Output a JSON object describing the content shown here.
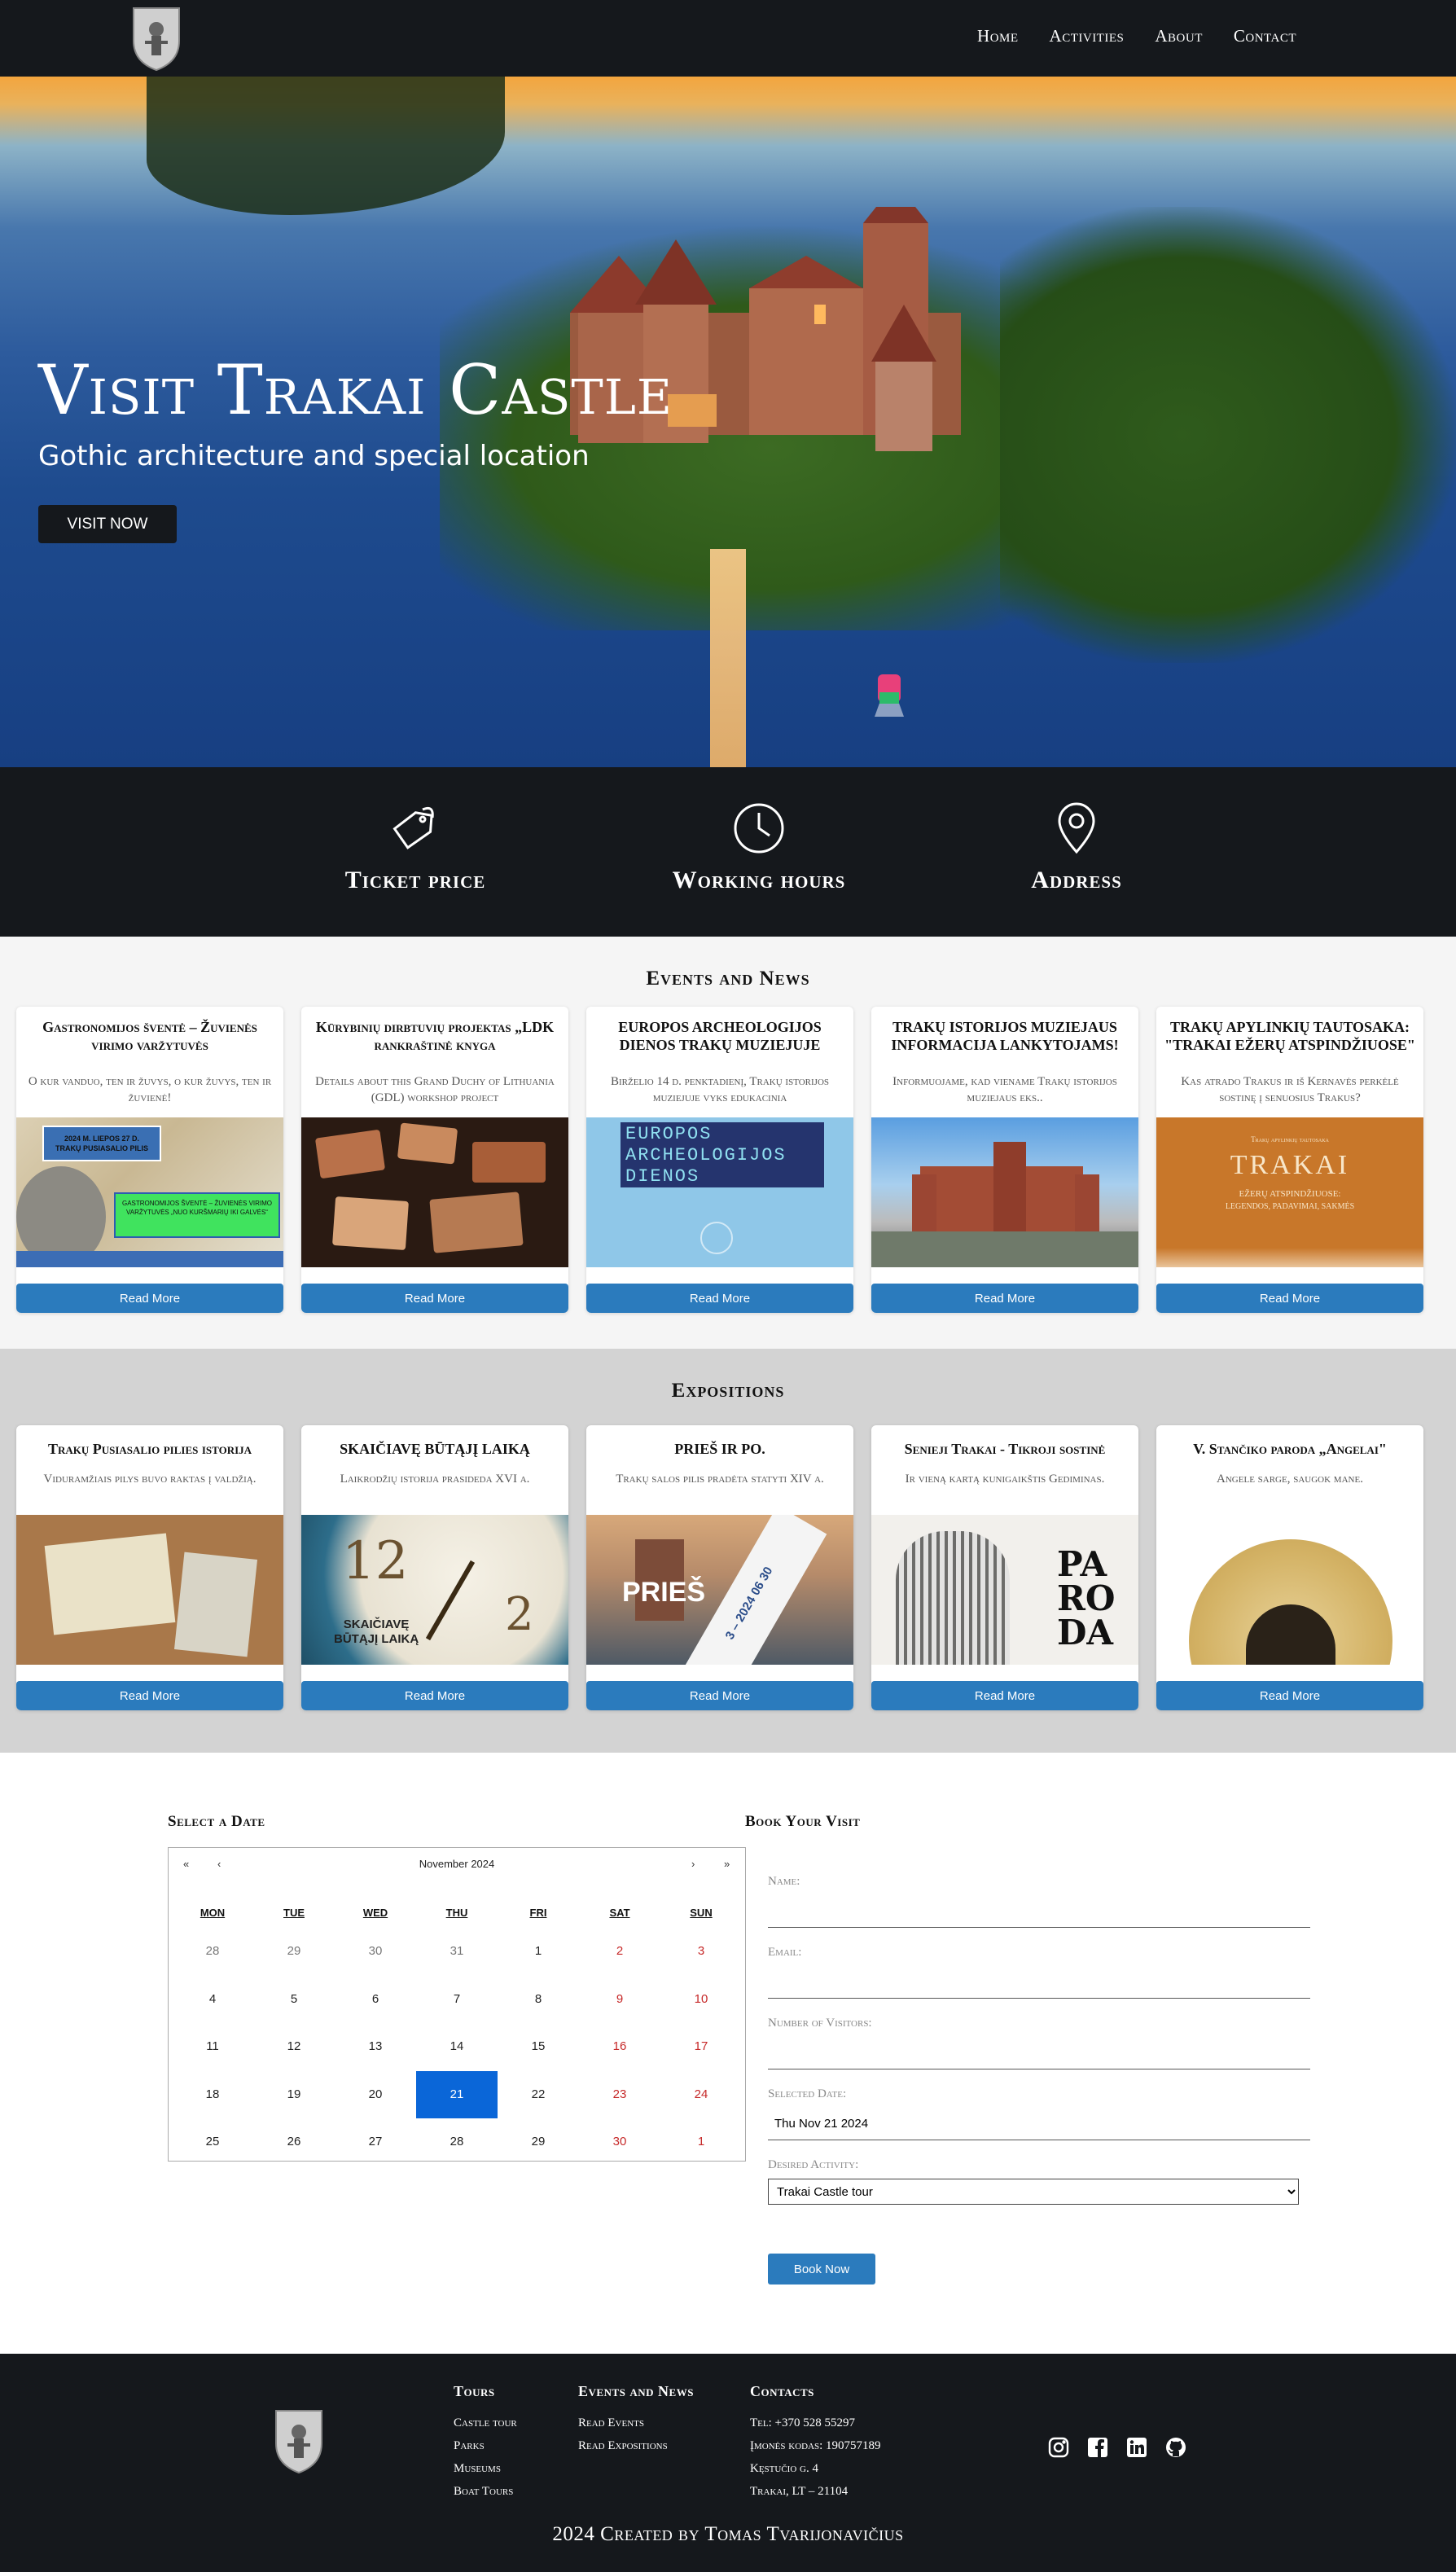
{
  "nav": {
    "links": [
      "Home",
      "Activities",
      "About",
      "Contact"
    ]
  },
  "hero": {
    "title": "Visit Trakai Castle",
    "subtitle": "Gothic architecture and special location",
    "button": "VISIT NOW"
  },
  "info": {
    "items": [
      {
        "label": "Ticket price",
        "icon": "price-tag-icon"
      },
      {
        "label": "Working hours",
        "icon": "clock-icon"
      },
      {
        "label": "Address",
        "icon": "map-pin-icon"
      }
    ]
  },
  "events": {
    "title": "Events and News",
    "read_more": "Read More",
    "cards": [
      {
        "title": "Gastronomijos šventė – Žuvienės virimo varžytuvės",
        "desc": "O kur vanduo, ten ir žuvys, o kur žuvys, ten ir žuvienė!",
        "image_text": [
          "2024 M. LIEPOS 27 D.",
          "TRAKŲ PUSIASALIO PILIS",
          "GASTRONOMIJOS ŠVENTĖ – ŽUVIENĖS VIRIMO VARŽYTUVĖS „NUO KURŠMARIŲ IKI GALVĖS“"
        ]
      },
      {
        "title": "Kūrybinių dirbtuvių projektas „LDK rankraštinė knyga",
        "desc": "Details about this Grand Duchy of Lithuania (GDL) workshop project",
        "image_text": []
      },
      {
        "title": "EUROPOS ARCHEOLOGIJOS DIENOS TRAKŲ MUZIEJUJE",
        "desc": "Birželio 14 d. penktadienį, Trakų istorijos muziejuje vyks edukacinia",
        "image_text": [
          "EUROPOS",
          "ARCHEOLOGIJOS",
          "DIENOS"
        ]
      },
      {
        "title": "TRAKŲ ISTORIJOS MUZIEJAUS INFORMACIJA LANKYTOJAMS!",
        "desc": "Informuojame, kad viename Trakų istorijos muziejaus eks..",
        "image_text": []
      },
      {
        "title": "TRAKŲ APYLINKIŲ TAUTOSAKA: \"TRAKAI EŽERŲ ATSPINDŽIUOSE\"",
        "desc": "Kas atrado Trakus ir iš Kernavės perkėlė sostinę į senuosius Trakus?",
        "image_text": [
          "Trakų apylinkių tautosaka",
          "TRAKAI",
          "EŽERŲ ATSPINDŽIUOSE:",
          "LEGENDOS, PADAVIMAI, SAKMĖS"
        ]
      }
    ]
  },
  "expositions": {
    "title": "Expositions",
    "read_more": "Read More",
    "cards": [
      {
        "title": "Trakų Pusiasalio pilies istorija",
        "desc": "Viduramžiais pilys buvo raktas į valdžią.",
        "image_text": []
      },
      {
        "title": "SKAIČIAVĘ BŪTĄJĮ LAIKĄ",
        "desc": "Laikrodžių istorija prasideda XVI a.",
        "image_text": [
          "SKAIČIAVĘ",
          "BŪTĄJĮ LAIKĄ"
        ]
      },
      {
        "title": "PRIEŠ IR PO.",
        "desc": "Trakų salos pilis pradėta statyti XIV a.",
        "image_text": [
          "PRIEŠ",
          "3 – 2024 06 30"
        ]
      },
      {
        "title": "Senieji Trakai - Tikroji sostinė",
        "desc": "Ir vieną kartą kunigaikštis Gediminas.",
        "image_text": [
          "PA",
          "RO",
          "DA"
        ]
      },
      {
        "title": "V. Stančiko paroda „Angelai\"",
        "desc": "Angele sarge, saugok mane.",
        "image_text": []
      }
    ]
  },
  "calendar": {
    "title": "Select a Date",
    "month_label": "November 2024",
    "nav": {
      "prev_year": "«",
      "prev_month": "‹",
      "next_month": "›",
      "next_year": "»"
    },
    "weekdays": [
      "MON",
      "TUE",
      "WED",
      "THU",
      "FRI",
      "SAT",
      "SUN"
    ],
    "weeks": [
      [
        "28",
        "29",
        "30",
        "31",
        "1",
        "2",
        "3"
      ],
      [
        "4",
        "5",
        "6",
        "7",
        "8",
        "9",
        "10"
      ],
      [
        "11",
        "12",
        "13",
        "14",
        "15",
        "16",
        "17"
      ],
      [
        "18",
        "19",
        "20",
        "21",
        "22",
        "23",
        "24"
      ],
      [
        "25",
        "26",
        "27",
        "28",
        "29",
        "30",
        "1"
      ]
    ],
    "selected": "21"
  },
  "booking": {
    "title": "Book Your Visit",
    "name_label": "Name:",
    "email_label": "Email:",
    "visitors_label": "Number of Visitors:",
    "date_label": "Selected Date:",
    "date_value": "Thu Nov 21 2024",
    "activity_label": "Desired Activity:",
    "activity_value": "Trakai Castle tour",
    "button": "Book Now"
  },
  "footer": {
    "columns": [
      {
        "heading": "Tours",
        "items": [
          "Castle tour",
          "Parks",
          "Museums",
          "Boat Tours"
        ]
      },
      {
        "heading": "Events and News",
        "items": [
          "Read Events",
          "Read Expositions"
        ]
      },
      {
        "heading": "Contacts",
        "items": [
          "Tel: +370 528 55297",
          "Įmonės kodas: 190757189",
          "Kęstučio g. 4",
          "Trakai, LT – 21104"
        ]
      }
    ],
    "social": [
      "instagram-icon",
      "facebook-icon",
      "linkedin-icon",
      "github-icon"
    ],
    "copyright": "2024 Created by Tomas Tvarijonavičius"
  },
  "colors": {
    "dark": "#15181c",
    "accent": "#2b7bbd",
    "selected_day": "#0a66d8",
    "weekend": "#c62828"
  }
}
